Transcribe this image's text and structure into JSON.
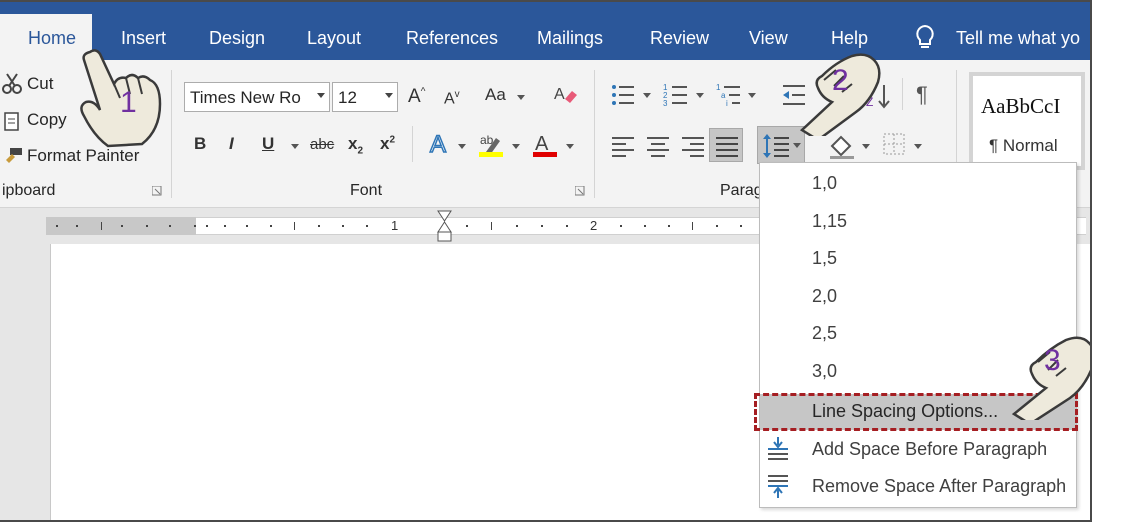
{
  "tabs": [
    {
      "label": "Home",
      "active": true
    },
    {
      "label": "Insert"
    },
    {
      "label": "Design"
    },
    {
      "label": "Layout"
    },
    {
      "label": "References"
    },
    {
      "label": "Mailings"
    },
    {
      "label": "Review"
    },
    {
      "label": "View"
    },
    {
      "label": "Help"
    }
  ],
  "tell_me": "Tell me what yo",
  "clipboard": {
    "cut": "Cut",
    "copy": "Copy",
    "format_painter": "Format Painter",
    "group_label": "ipboard"
  },
  "font": {
    "name": "Times New Ro",
    "size": "12",
    "group_label": "Font",
    "bold": "B",
    "italic": "I",
    "underline": "U",
    "strike": "abc",
    "sub": "x",
    "sup": "x",
    "grow": "A",
    "shrink": "A",
    "case": "Aa"
  },
  "paragraph": {
    "group_label": "Parag"
  },
  "styles": {
    "preview": "AaBbCcI",
    "name": "¶ Normal"
  },
  "ruler": {
    "n1": "1",
    "n2": "2"
  },
  "line_spacing_menu": {
    "options": [
      "1,0",
      "1,15",
      "1,5",
      "2,0",
      "2,5",
      "3,0"
    ],
    "line_spacing_options": "Line Spacing Options...",
    "add_space_before": "Add Space Before Paragraph",
    "remove_space_after": "Remove Space After Paragraph"
  },
  "steps": {
    "s1": "1",
    "s2": "2",
    "s3": "3"
  },
  "colors": {
    "ribbon_blue": "#2b579a",
    "step_purple": "#7030a0",
    "highlight_box": "#a51e22"
  }
}
